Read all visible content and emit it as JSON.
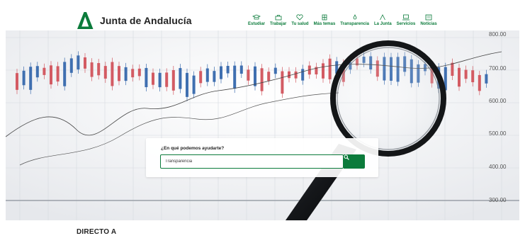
{
  "brand": {
    "name": "Junta de Andalucía",
    "color": "#0b7b3b"
  },
  "nav": {
    "items": [
      {
        "label": "Estudiar",
        "icon": "graduation-cap-icon"
      },
      {
        "label": "Trabajar",
        "icon": "briefcase-icon"
      },
      {
        "label": "Tu salud",
        "icon": "heart-icon"
      },
      {
        "label": "Más temas",
        "icon": "grid-icon"
      },
      {
        "label": "Transparencia",
        "icon": "drop-icon"
      },
      {
        "label": "La Junta",
        "icon": "junta-logo-icon"
      },
      {
        "label": "Servicios",
        "icon": "laptop-icon"
      },
      {
        "label": "Noticias",
        "icon": "newspaper-icon"
      }
    ]
  },
  "hero": {
    "axis_labels": [
      "800.00",
      "700.00",
      "600.00",
      "500.00",
      "400.00",
      "300.00"
    ]
  },
  "search": {
    "title": "¿En qué podemos ayudarte?",
    "value": "Transparencia",
    "button_icon": "search-icon"
  },
  "sections": {
    "direct_title": "DIRECTO A"
  }
}
